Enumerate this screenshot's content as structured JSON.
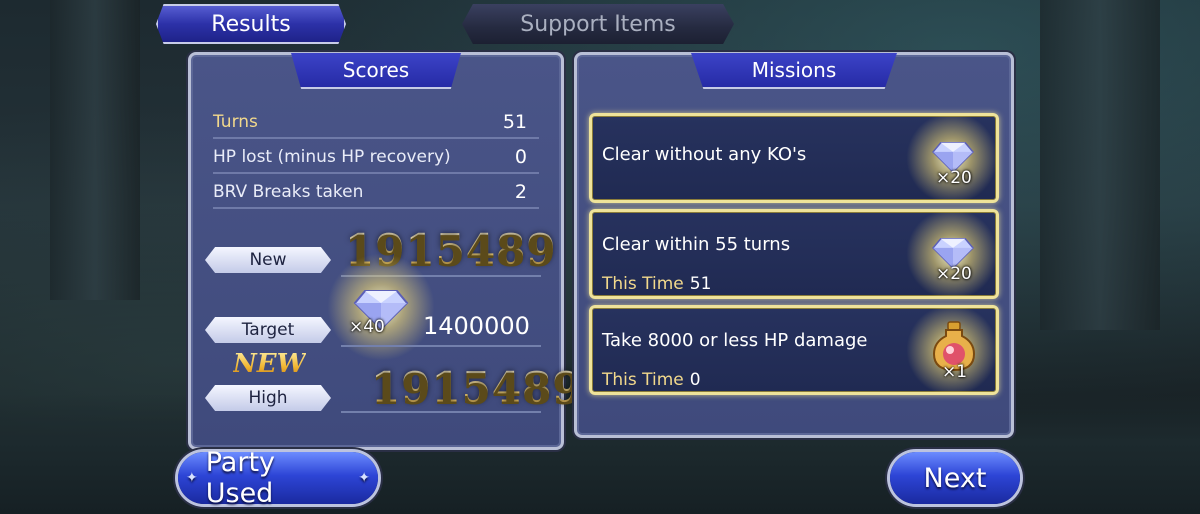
{
  "tabs": {
    "results": "Results",
    "support": "Support Items"
  },
  "scores": {
    "header": "Scores",
    "rows": [
      {
        "label": "Turns",
        "value": "51"
      },
      {
        "label": "HP lost (minus HP recovery)",
        "value": "0"
      },
      {
        "label": "BRV Breaks taken",
        "value": "2"
      }
    ],
    "new_label": "New",
    "new_value": "1915489",
    "target_label": "Target",
    "target_reward": "×40",
    "target_value": "1400000",
    "new_badge": "NEW",
    "high_label": "High",
    "high_value": "1915489"
  },
  "missions": {
    "header": "Missions",
    "items": [
      {
        "text": "Clear without any KO's",
        "sub_label": "",
        "sub_value": "",
        "reward": "×20",
        "reward_icon": "crystal-gem-icon"
      },
      {
        "text": "Clear within 55 turns",
        "sub_label": "This Time",
        "sub_value": "51",
        "reward": "×20",
        "reward_icon": "crystal-gem-icon"
      },
      {
        "text": "Take 8000 or less HP damage",
        "sub_label": "This Time",
        "sub_value": "0",
        "reward": "×1",
        "reward_icon": "potion-flask-icon"
      }
    ]
  },
  "buttons": {
    "party": "Party Used",
    "next": "Next"
  },
  "colors": {
    "accent": "#2c31a8",
    "gold": "#f2d98c",
    "panel": "#424d80"
  }
}
